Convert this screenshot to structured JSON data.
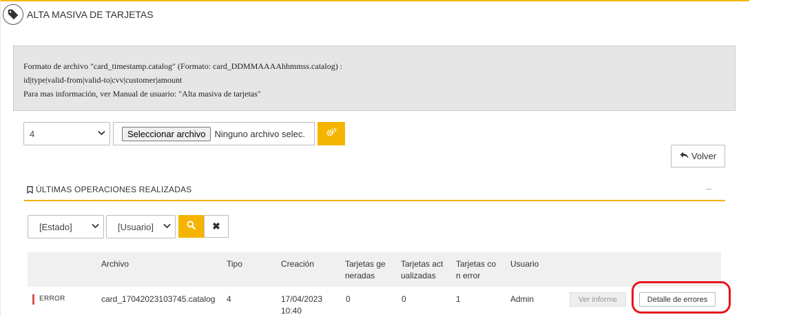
{
  "page": {
    "title": "ALTA MASIVA DE TARJETAS",
    "title_icon": "tag-icon"
  },
  "info": {
    "line1": "Formato de archivo \"card_timestamp.catalog\" (Formato: card_DDMMAAAAhhmmss.catalog) :",
    "line2": "id|type|valid-from|valid-to|cvv|customer|amount",
    "line3": "Para mas información, ver Manual de usuario: \"Alta masiva de tarjetas\""
  },
  "upload": {
    "select_value": "4",
    "file_button_label": "Seleccionar archivo",
    "file_status": "Ninguno archivo selec.",
    "process_icon": "cogs-icon"
  },
  "volver": {
    "label": "Volver",
    "icon": "reply-arrow-icon"
  },
  "section": {
    "title": "ÚLTIMAS OPERACIONES REALIZADAS",
    "icon": "bookmark-icon",
    "collapse_symbol": "–"
  },
  "filters": {
    "estado": "[Estado]",
    "usuario": "[Usuario]",
    "search_icon": "search-icon",
    "clear_symbol": "✖"
  },
  "table": {
    "headers": {
      "archivo": "Archivo",
      "tipo": "Tipo",
      "creacion": "Creación",
      "generadas_1": "Tarjetas ge",
      "generadas_2": "neradas",
      "actualizadas_1": "Tarjetas act",
      "actualizadas_2": "ualizadas",
      "error_1": "Tarjetas co",
      "error_2": "n error",
      "usuario": "Usuario"
    },
    "rows": [
      {
        "status": "ERROR",
        "archivo": "card_17042023103745.catalog",
        "tipo": "4",
        "creacion_fecha": "17/04/2023",
        "creacion_hora": "10:40",
        "generadas": "0",
        "actualizadas": "0",
        "error": "1",
        "usuario": "Admin",
        "ver_informe": "Ver informe",
        "detalle": "Detalle de errores"
      }
    ]
  },
  "colors": {
    "accent": "#f5b400",
    "error": "#d9534f",
    "highlight": "#e8151b"
  }
}
